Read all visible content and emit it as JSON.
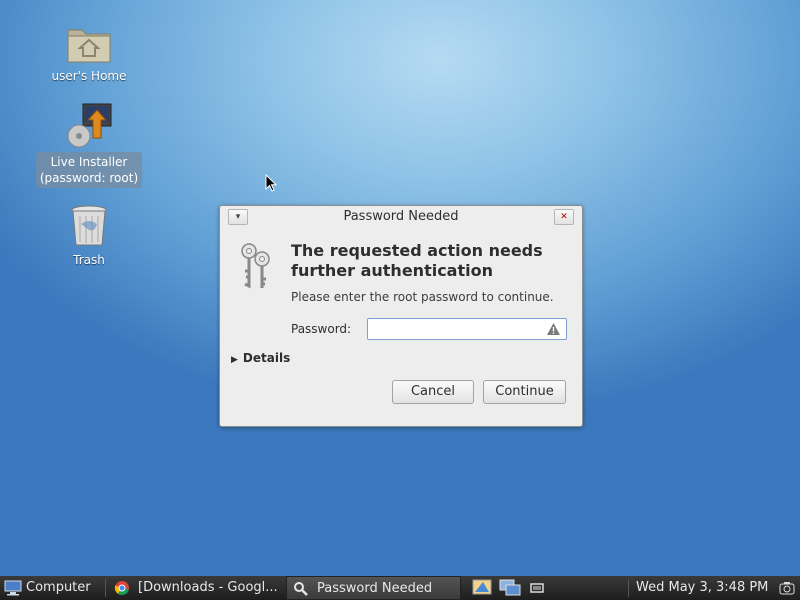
{
  "desktop": {
    "icons": [
      {
        "label": "user's Home",
        "icon": "home-folder-icon"
      },
      {
        "label_line1": "Live Installer",
        "label_line2": "(password: root)",
        "icon": "installer-icon"
      },
      {
        "label": "Trash",
        "icon": "trash-icon"
      }
    ]
  },
  "dialog": {
    "title": "Password Needed",
    "headline_line1": "The requested action needs",
    "headline_line2": "further authentication",
    "subtext": "Please enter the root password to continue.",
    "password_label": "Password:",
    "password_value": "",
    "details_label": "Details",
    "cancel_label": "Cancel",
    "continue_label": "Continue"
  },
  "taskbar": {
    "menu_label": "Computer",
    "windows": [
      {
        "label": "[Downloads - Googl...",
        "icon": "chrome-icon"
      },
      {
        "label": "Password Needed",
        "icon": "magnifier-key-icon"
      }
    ],
    "clock": "Wed May  3,  3:48 PM"
  },
  "colors": {
    "desktop_bg": "#5f9ed4",
    "dialog_bg": "#ededed",
    "taskbar_bg": "#2a2a2a",
    "input_focus": "#7d9fd3"
  }
}
